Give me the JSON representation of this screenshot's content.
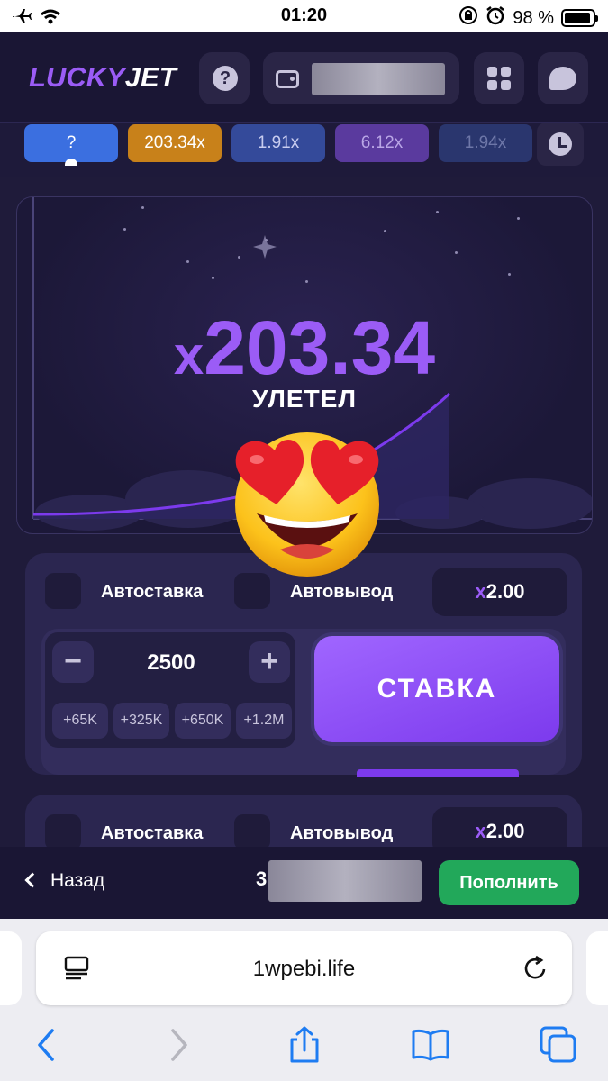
{
  "status_bar": {
    "time": "01:20",
    "battery": "98 %"
  },
  "header": {
    "logo_part1": "LUCKY",
    "logo_part2": "JET",
    "help_label": "?"
  },
  "history": {
    "items": [
      {
        "label": "?",
        "color": "#3b6fe0"
      },
      {
        "label": "203.34x",
        "color": "#c8811a"
      },
      {
        "label": "1.91x",
        "color": "#344a9a"
      },
      {
        "label": "6.12x",
        "color": "#5a3a9e"
      },
      {
        "label": "1.94x",
        "color": "#2a366e"
      }
    ]
  },
  "game": {
    "multiplier_prefix": "x",
    "multiplier_value": "203.34",
    "status": "УЛЕТЕЛ"
  },
  "bet_panel_1": {
    "autobet_label": "Автоставка",
    "autocashout_label": "Автовывод",
    "autocashout_prefix": "x",
    "autocashout_value": "2.00",
    "amount": "2500",
    "minus": "−",
    "plus": "+",
    "quick_amounts": [
      "+65K",
      "+325K",
      "+650K",
      "+1.2M"
    ],
    "bet_button": "СТАВКА"
  },
  "bet_panel_2": {
    "autobet_label": "Автоставка",
    "autocashout_label": "Автовывод",
    "autocashout_prefix": "x",
    "autocashout_value": "2.00"
  },
  "bottom_bar": {
    "back_label": "Назад",
    "balance_visible": "3",
    "deposit_label": "Пополнить"
  },
  "browser": {
    "url": "1wpebi.life"
  },
  "colors": {
    "accent": "#9b5cf6",
    "deposit": "#22a85a"
  }
}
